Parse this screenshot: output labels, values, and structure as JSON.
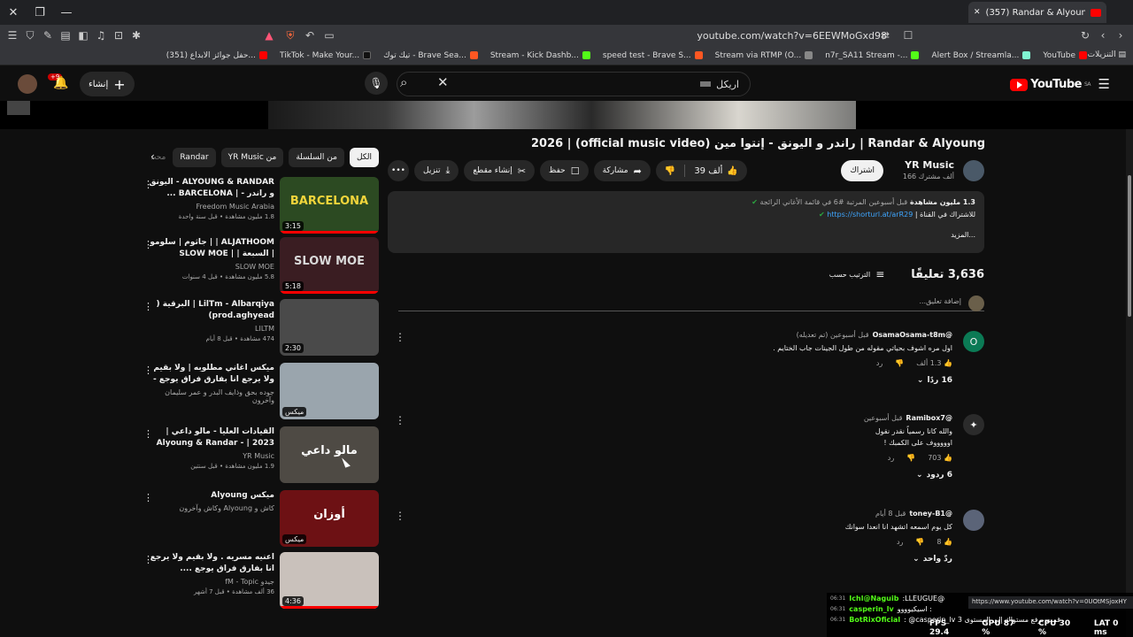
{
  "browser": {
    "tab_title": "(357) Randar & Alyoung - Ento m",
    "url": "youtube.com/watch?v=6EEWMoGxd98",
    "bookmarks": [
      {
        "label": "حفل جوائز الابداع (351)...",
        "color": "#ff0000"
      },
      {
        "label": "TikTok - Make Your...",
        "color": "#111111"
      },
      {
        "label": "تيك توك - Brave Sea...",
        "color": "#ff5722"
      },
      {
        "label": "Stream - Kick Dashb...",
        "color": "#53fc18"
      },
      {
        "label": "speed test - Brave S...",
        "color": "#ff5722"
      },
      {
        "label": "Stream via RTMP (O...",
        "color": "#888888"
      },
      {
        "label": "n7r_SA11 Stream -...",
        "color": "#53fc18"
      },
      {
        "label": "Alert Box / Streamla...",
        "color": "#80f5d2"
      },
      {
        "label": "YouTube",
        "color": "#ff0000"
      }
    ],
    "all_bookmarks": "التنزيلات"
  },
  "header": {
    "search_value": "اريكل",
    "create_label": "إنشاء",
    "notif_count": "+9",
    "logo_text": "YouTube",
    "logo_region": "SA"
  },
  "video": {
    "title": "2026 | (official music video) راندر و اليونق - إنتوا مين | Randar & Alyoung - Ento meen",
    "channel": "YR Music",
    "subscribers": "166 ألف مشترك",
    "subscribe_label": "اشتراك",
    "likes": "39 ألف",
    "share_label": "مشاركة",
    "save_label": "حفظ",
    "clip_label": "إنشاء مقطع",
    "download_label": "تنزيل",
    "description": {
      "views": "1.3 مليون مشاهدة",
      "date": "قبل أسبوعين",
      "ranking": "المرتبة #6 في قائمة الأغاني الرائجة",
      "live_prefix": "للاشتراك في القناة |",
      "link": "https://shorturl.at/arR29",
      "more": "...المزيد"
    }
  },
  "comments": {
    "count": "3,636 تعليقًا",
    "sort_label": "الترتيب حسب",
    "add_placeholder": "إضافة تعليق...",
    "items": [
      {
        "user": "@OsamaOsama-t8m",
        "when": "قبل أسبوعين (تم تعديله)",
        "text": "اول مره اشوف بحياتي مقوله من طول الجينات جاب الختايم .",
        "likes": "1.3 ألف",
        "reply": "رد",
        "replies": "16 ردًا",
        "avatar_letter": "O",
        "avatar_color": "#0b7a55"
      },
      {
        "user": "@Ramibox7",
        "when": "قبل أسبوعين",
        "text": "والله كانا رسمياً نقدر نقول\nاوووووف على الكمبك !",
        "likes": "703",
        "reply": "رد",
        "replies": "6 ردود",
        "avatar_letter": "✦",
        "avatar_color": "#2b2b2b"
      },
      {
        "user": "@toney-B1",
        "when": "قبل 8 أيام",
        "text": "كل يوم اسمعه اتشهد انا انعدا سوانك",
        "likes": "8",
        "reply": "رد",
        "replies": "ردّ واحد",
        "avatar_letter": "",
        "avatar_color": "#5b6478"
      }
    ]
  },
  "chips": [
    {
      "label": "الكل",
      "active": true
    },
    {
      "label": "من السلسلة",
      "active": false
    },
    {
      "label": "من YR Music",
      "active": false
    },
    {
      "label": "Randar",
      "active": false
    },
    {
      "label": "محت",
      "active": false
    }
  ],
  "recommendations": [
    {
      "title": "ALYOUNG & RANDAR - اليونق و راندر - | BARCELONA ...",
      "channel": "Freedom Music Arabia",
      "meta": "1.8 مليون مشاهدة • قبل سنة واحدة",
      "duration": "3:15",
      "thumb": "#2c4a22",
      "thumb_text": "BARCELONA",
      "thumb_text_color": "#f2d53b",
      "progress": 1.0
    },
    {
      "title": "ALJATHOOM | | جاثوم | سلومو | السبعة | SLOW MOE | SEVEN",
      "channel": "SLOW MOE",
      "meta": "5.8 مليون مشاهدة • قبل 4 سنوات",
      "duration": "5:18",
      "thumb": "#3a1d22",
      "thumb_text": "SLOW MOE",
      "thumb_text_color": "#d9d9d9",
      "progress": 1.0
    },
    {
      "title": "LilTm - Albarqiya | البرقية ( prod.aghyead)",
      "channel": "LILTM",
      "meta": "474 مشاهدة • قبل 8 أيام",
      "duration": "2:30",
      "thumb": "#4a4a4a",
      "thumb_text": "",
      "thumb_text_color": "#ffffff",
      "progress": 0
    },
    {
      "title": "ميكس اغاني مطلوبه | ولا بقيم ولا يرجع انا بفارق فراق يوجع - تحديل مطلوب .",
      "channel": "جوده بحق وذايف البدر و عمر سليمان وآخرون",
      "meta": "",
      "duration": "ميكس",
      "thumb": "#9aa5ad",
      "thumb_text": "",
      "thumb_text_color": "#ffffff",
      "progress": 0
    },
    {
      "title": "القيادات العليا - مالو داعي | 2023 | Alyoung & Randar - Malo Da3y...",
      "channel": "YR Music",
      "meta": "1.9 مليون مشاهدة • قبل سنتين",
      "duration": "",
      "thumb": "#4e4a44",
      "thumb_text": "مالو داعي",
      "thumb_text_color": "#ffffff",
      "progress": 0
    },
    {
      "title": "ميكس Alyoung",
      "channel": "كاش و Alyoung وكاش وآخرون",
      "meta": "",
      "duration": "ميكس",
      "thumb": "#6d1114",
      "thumb_text": "أوزان",
      "thumb_text_color": "#ffffff",
      "progress": 0
    },
    {
      "title": "اعنيه مسريه . ولا بقيم ولا يرجع انا بفارق فراق يوجع ....",
      "channel": "جيدو fM - Topic",
      "meta": "36 ألف مشاهدة • قبل 7 أشهر",
      "duration": "4:36",
      "thumb": "#c9c1bb",
      "thumb_text": "",
      "thumb_text_color": "#ffffff",
      "progress": 1.0
    }
  ],
  "overlay": {
    "chat": [
      {
        "time": "06:31",
        "user": "Ichl@Naguib",
        "text": ":LLEUGUE@"
      },
      {
        "time": "06:31",
        "user": "casperin_lv",
        "text": "اسيكيوووو :"
      },
      {
        "time": "06:31",
        "user": "BotRixOficial",
        "text": ": @casperin_lv 3 قمت برفع مستواك إلى المستوى"
      }
    ],
    "url_tooltip": "https://www.youtube.com/watch?v=0UOtMSjoxHY",
    "stats": {
      "fps": "FPS 29.4",
      "gpu": "GPU 87 %",
      "cpu": "CPU 30 %",
      "lat": "LAT 0 ms"
    }
  }
}
